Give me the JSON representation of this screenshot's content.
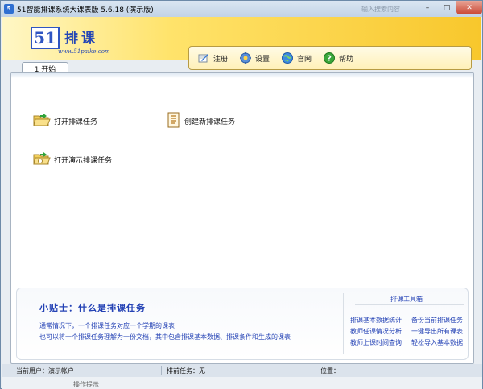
{
  "window": {
    "title": "51智能排课系统大课表版 5.6.18 (演示版)",
    "ghost_text": "输入搜索内容",
    "controls": {
      "minimize": "–",
      "maximize": "□",
      "close": "✕"
    }
  },
  "banner": {
    "logo_digits": "51",
    "logo_name": "排课",
    "logo_url": "www.51paike.com",
    "toolbar": {
      "register": "注册",
      "settings": "设置",
      "website": "官网",
      "help": "帮助"
    }
  },
  "tabs": [
    {
      "label": "1 开始"
    }
  ],
  "actions": {
    "open_task": "打开排课任务",
    "new_task": "创建新排课任务",
    "open_demo": "打开演示排课任务"
  },
  "tips": {
    "title": "小贴士：什么是排课任务",
    "line1": "通常情况下，一个排课任务对应一个学期的课表",
    "line2": "也可以将一个排课任务理解为一份文档，其中包含排课基本数据、排课条件和生成的课表"
  },
  "toolbox": {
    "title": "排课工具箱",
    "items": [
      "排课基本数据统计",
      "备份当前排课任务",
      "教师任课情况分析",
      "一键导出所有课表",
      "教师上课时间查询",
      "轻松导入基本数据"
    ]
  },
  "statusbar": {
    "user": "当前用户：演示帐户",
    "task": "排前任务：无",
    "position": "位置：",
    "bottom_hint": "操作提示"
  },
  "colors": {
    "banner_start": "#fff7c6",
    "banner_end": "#f8c72c",
    "link_blue": "#2442b5",
    "close_red": "#c94532"
  }
}
